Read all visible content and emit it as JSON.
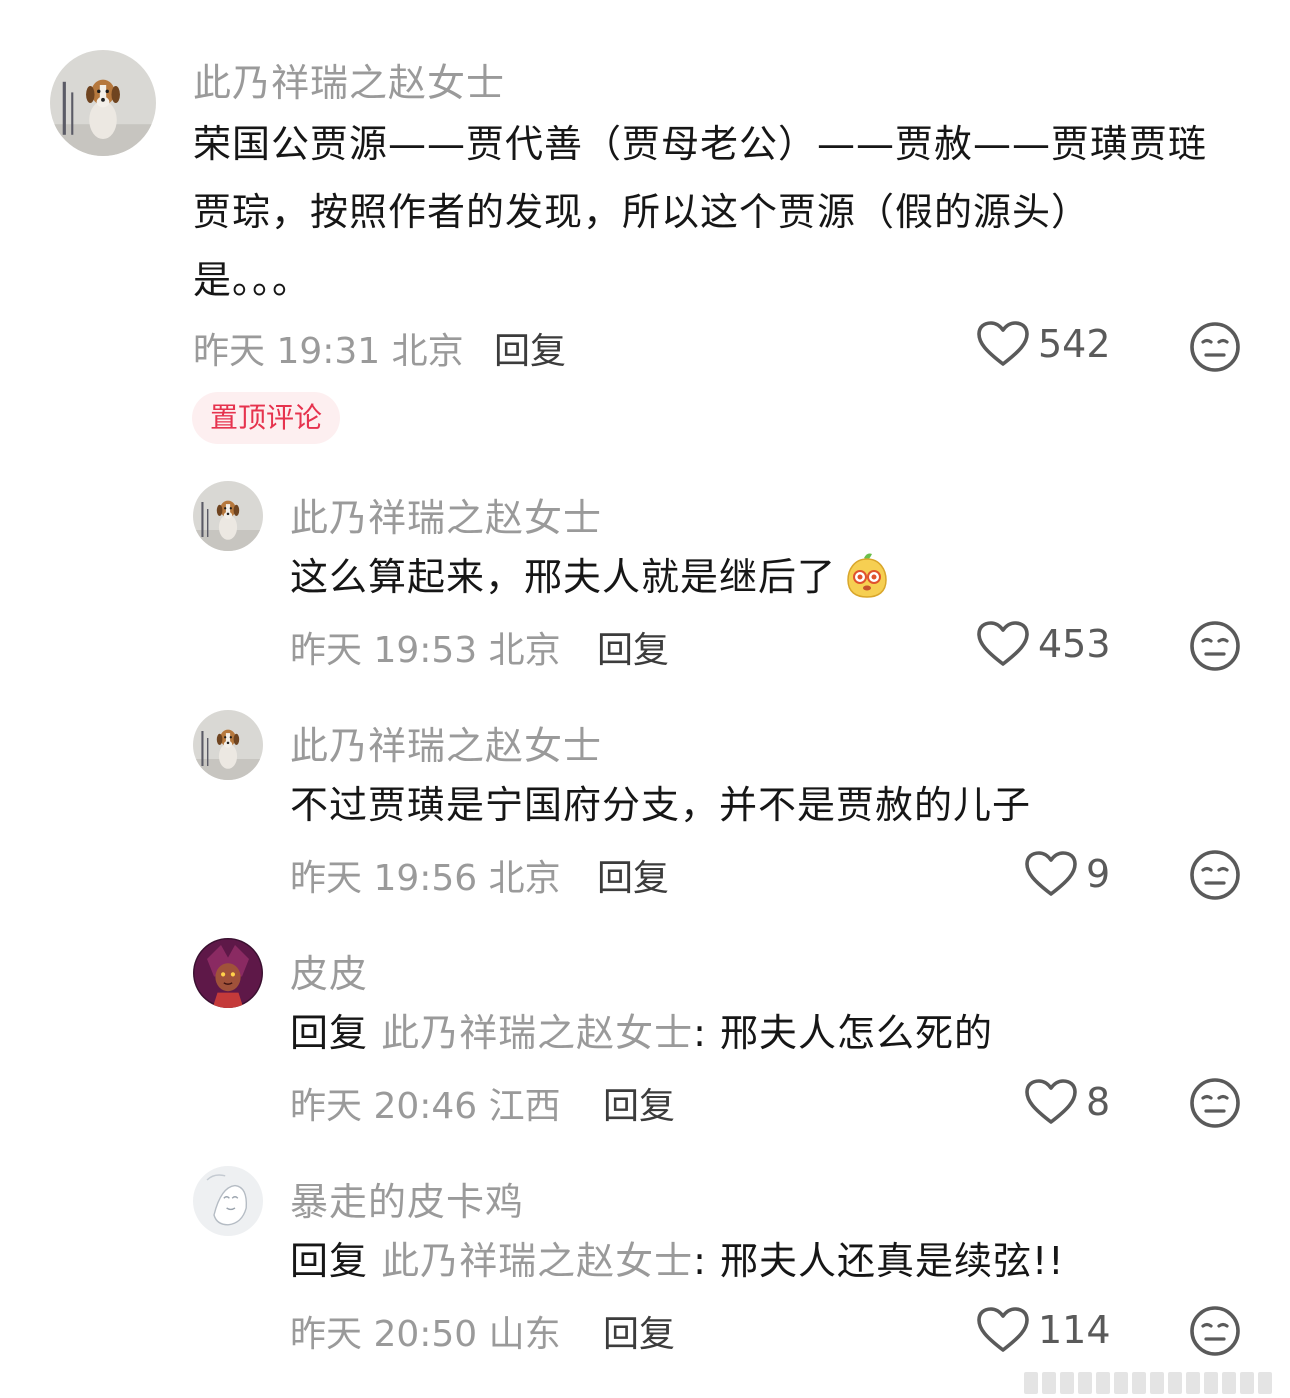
{
  "comments": [
    {
      "author": "此乃祥瑞之赵女士",
      "lines": [
        "荣国公贾源——贾代善（贾母老公）——贾赦——贾璜贾琏",
        "贾琮，按照作者的发现，所以这个贾源（假的源头）",
        "是。。。"
      ],
      "time": "昨天 19:31 北京",
      "reply_label": "回复",
      "likes": "542",
      "pin_label": "置顶评论"
    }
  ],
  "replies": [
    {
      "author": "此乃祥瑞之赵女士",
      "text": "这么算起来，邢夫人就是继后了",
      "emoji": "bean-face-emoji",
      "time": "昨天 19:53 北京",
      "reply_label": "回复",
      "likes": "453"
    },
    {
      "author": "此乃祥瑞之赵女士",
      "text": "不过贾璜是宁国府分支，并不是贾赦的儿子",
      "time": "昨天 19:56 北京",
      "reply_label": "回复",
      "likes": "9"
    },
    {
      "author": "皮皮",
      "reply_prefix": "回复",
      "mention": "此乃祥瑞之赵女士",
      "text": ": 邢夫人怎么死的",
      "time": "昨天 20:46 江西",
      "reply_label": "回复",
      "likes": "8"
    },
    {
      "author": "暴走的皮卡鸡",
      "reply_prefix": "回复",
      "mention": "此乃祥瑞之赵女士",
      "text": ": 邢夫人还真是续弦!!",
      "time": "昨天 20:50 山东",
      "reply_label": "回复",
      "likes": "114"
    }
  ],
  "icons": {
    "like": "heart-outline-icon",
    "dislike": "meh-face-icon"
  },
  "colors": {
    "pin_badge_bg": "#fdeff0",
    "pin_badge_text": "#e6334e",
    "secondary_text": "#9a9a9a"
  }
}
